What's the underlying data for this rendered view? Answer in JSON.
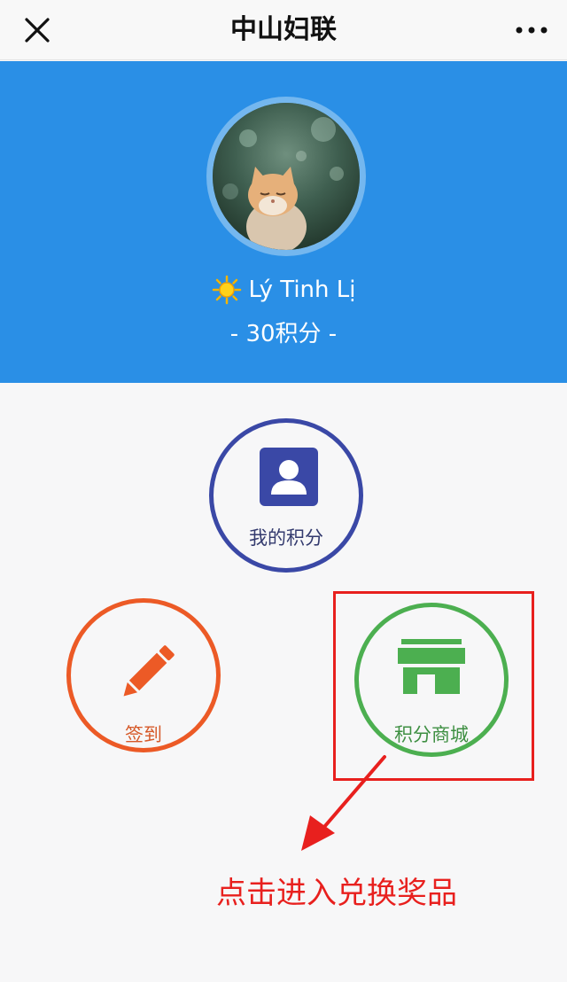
{
  "navbar": {
    "title": "中山妇联",
    "close_icon": "close-icon",
    "more_icon": "more-icon"
  },
  "profile": {
    "name": "Lý Tinh Lị",
    "points": "- 30积分 -",
    "name_icon": "sun-icon"
  },
  "actions": {
    "my_points": "我的积分",
    "checkin": "签到",
    "mall": "积分商城"
  },
  "annotation": {
    "text": "点击进入兑换奖品"
  },
  "colors": {
    "header_blue": "#2a8fe6",
    "indigo": "#3a48a6",
    "orange": "#ec5a26",
    "green": "#4caf50",
    "annotation_red": "#e8201e"
  }
}
